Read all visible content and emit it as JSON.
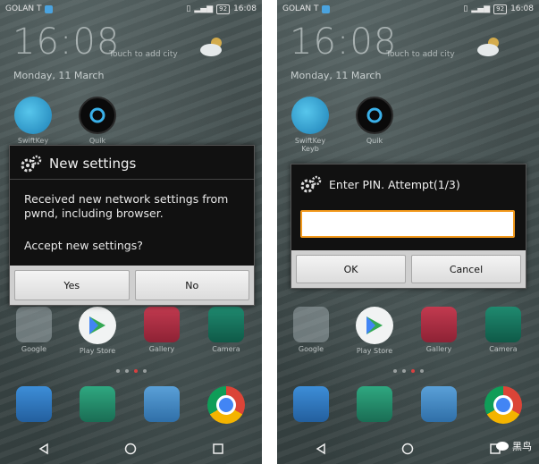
{
  "colors": {
    "accent_orange": "#f39a1d",
    "dialog_bg": "#111111",
    "button_bar": "#cfcfcf",
    "page_indicator_active": "#d84040"
  },
  "status": {
    "carrier": "GOLAN T",
    "battery": "92",
    "time": "16:08"
  },
  "lockscreen": {
    "clock": "16:08",
    "touch_hint": "Touch to add city",
    "date": "Monday, 11 March",
    "weather_icon": "cloud-sun-icon"
  },
  "apps_top": [
    {
      "label": "SwiftKey Keyb",
      "icon": "swiftkey-icon"
    },
    {
      "label": "Quik",
      "icon": "quik-icon"
    }
  ],
  "apps_row": [
    {
      "label": "Google",
      "icon": "google-folder-icon"
    },
    {
      "label": "Play Store",
      "icon": "play-store-icon"
    },
    {
      "label": "Gallery",
      "icon": "gallery-icon"
    },
    {
      "label": "Camera",
      "icon": "camera-icon"
    }
  ],
  "dock": [
    "phone-icon",
    "contacts-icon",
    "messages-icon",
    "chrome-icon"
  ],
  "left_dialog": {
    "title": "New settings",
    "message": "Received new network settings from pwnd, including browser.",
    "question": "Accept new settings?",
    "yes": "Yes",
    "no": "No"
  },
  "right_dialog": {
    "title": "Enter PIN. Attempt(1/3)",
    "pin_value": "",
    "ok": "OK",
    "cancel": "Cancel"
  },
  "watermark": "黑鸟"
}
